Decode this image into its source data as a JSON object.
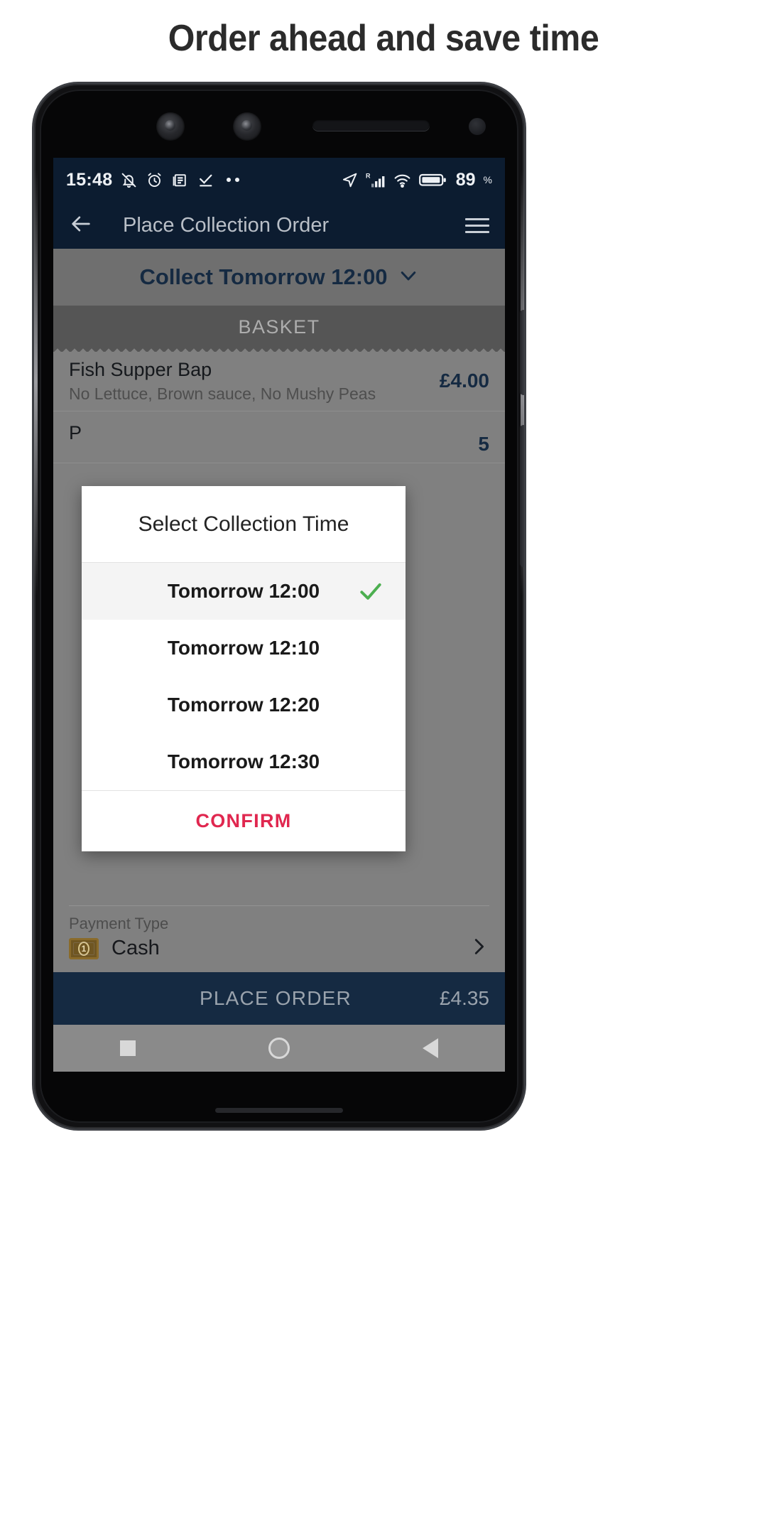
{
  "page": {
    "title": "Order ahead and save time"
  },
  "status_bar": {
    "time": "15:48",
    "icons_left": [
      "bell-off-icon",
      "alarm-clock-icon",
      "news-icon",
      "check-underline-icon"
    ],
    "dots": 2,
    "icons_right": [
      "location-arrow-icon",
      "roaming-signal-icon",
      "wifi-icon",
      "battery-icon"
    ],
    "roaming_letter": "R",
    "battery_level": "89",
    "battery_unit": "%",
    "background_color": "#0c1c30"
  },
  "app_bar": {
    "back_icon": "arrow-left-icon",
    "title": "Place Collection Order",
    "menu_icon": "hamburger-icon",
    "background_color": "#0c1c30"
  },
  "collect_bar": {
    "label": "Collect Tomorrow 12:00",
    "chevron_icon": "chevron-down-icon"
  },
  "basket": {
    "header": "BASKET",
    "items": [
      {
        "name": "Fish Supper Bap",
        "options": "No Lettuce, Brown sauce, No Mushy Peas",
        "price": "£4.00"
      },
      {
        "name": "P",
        "options": "",
        "price": "5"
      }
    ]
  },
  "payment": {
    "label": "Payment Type",
    "value": "Cash",
    "icon": "banknote-icon",
    "icon_glyph": " ",
    "chevron_icon": "chevron-right-icon"
  },
  "place_order": {
    "label": "PLACE ORDER",
    "total": "£4.35",
    "background_color": "#152a42"
  },
  "nav_bar": {
    "recents_icon": "square-icon",
    "home_icon": "circle-icon",
    "back_icon": "triangle-back-icon"
  },
  "dialog": {
    "title": "Select Collection Time",
    "options": [
      {
        "label": "Tomorrow 12:00",
        "selected": true
      },
      {
        "label": "Tomorrow 12:10",
        "selected": false
      },
      {
        "label": "Tomorrow 12:20",
        "selected": false
      },
      {
        "label": "Tomorrow 12:30",
        "selected": false
      }
    ],
    "check_icon": "check-icon",
    "check_color": "#4caf50",
    "confirm_label": "CONFIRM",
    "confirm_color": "#e0274f"
  }
}
